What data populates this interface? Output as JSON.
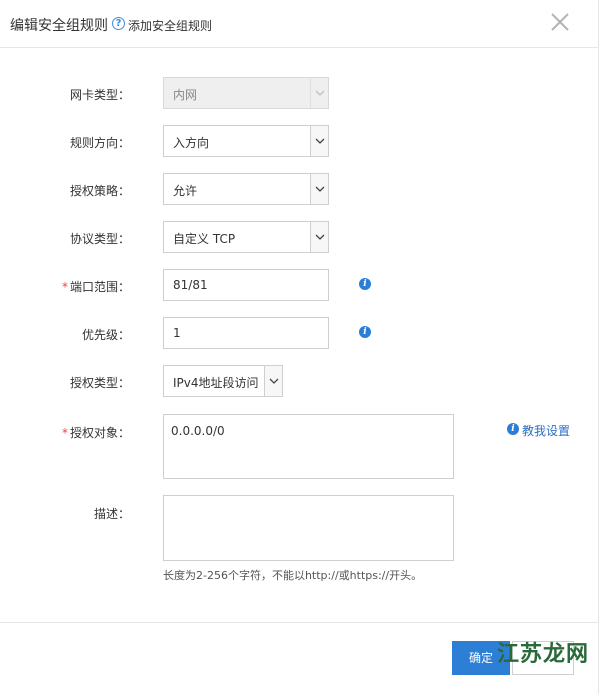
{
  "dialog": {
    "title": "编辑安全组规则",
    "help_glyph": "?",
    "help_link": "添加安全组规则",
    "close_glyph": "×"
  },
  "form": {
    "nic_type": {
      "label": "网卡类型：",
      "value": "内网"
    },
    "direction": {
      "label": "规则方向：",
      "value": "入方向"
    },
    "policy": {
      "label": "授权策略：",
      "value": "允许"
    },
    "protocol": {
      "label": "协议类型：",
      "value": "自定义 TCP"
    },
    "port_range": {
      "label": "端口范围：",
      "value": "81/81",
      "required": "*"
    },
    "priority": {
      "label": "优先级：",
      "value": "1"
    },
    "auth_type": {
      "label": "授权类型：",
      "value": "IPv4地址段访问"
    },
    "auth_object": {
      "label": "授权对象：",
      "value": "0.0.0.0/0",
      "required": "*",
      "help_link": "教我设置"
    },
    "description": {
      "label": "描述：",
      "value": "",
      "hint": "长度为2-256个字符，不能以http://或https://开头。"
    }
  },
  "footer": {
    "ok_label": "确定"
  },
  "watermark": {
    "text": "江苏龙网"
  },
  "colors": {
    "primary": "#2d7fd6",
    "required": "#e5474b",
    "link": "#2b6fc2"
  },
  "icons": {
    "help": "question-circle-icon",
    "info": "info-circle-icon",
    "close": "close-icon",
    "dropdown": "chevron-down-icon"
  }
}
